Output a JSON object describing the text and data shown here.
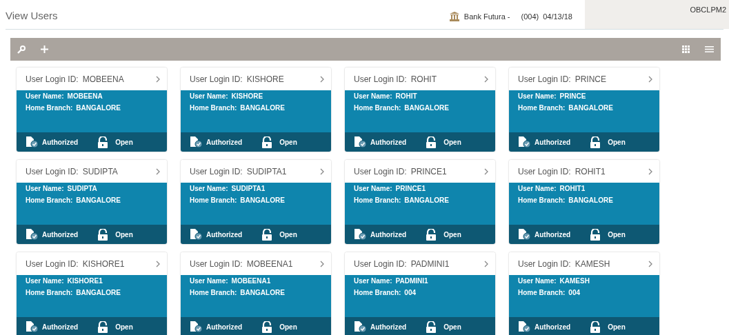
{
  "page": {
    "title": "View Users"
  },
  "header": {
    "bank": "Bank Futura -",
    "branch": "(004)",
    "date": "04/13/18",
    "user": "OBCLPM2"
  },
  "users": [
    {
      "login_label": "User Login ID:",
      "login_id": "MOBEENA",
      "name_label": "User Name:",
      "user_name": "MOBEENA",
      "branch_label": "Home Branch:",
      "home_branch": "BANGALORE",
      "auth_status": "Authorized",
      "record_status": "Open"
    },
    {
      "login_label": "User Login ID:",
      "login_id": "KISHORE",
      "name_label": "User Name:",
      "user_name": "KISHORE",
      "branch_label": "Home Branch:",
      "home_branch": "BANGALORE",
      "auth_status": "Authorized",
      "record_status": "Open"
    },
    {
      "login_label": "User Login ID:",
      "login_id": "ROHIT",
      "name_label": "User Name:",
      "user_name": "ROHIT",
      "branch_label": "Home Branch:",
      "home_branch": "BANGALORE",
      "auth_status": "Authorized",
      "record_status": "Open"
    },
    {
      "login_label": "User Login ID:",
      "login_id": "PRINCE",
      "name_label": "User Name:",
      "user_name": "PRINCE",
      "branch_label": "Home Branch:",
      "home_branch": "BANGALORE",
      "auth_status": "Authorized",
      "record_status": "Open"
    },
    {
      "login_label": "User Login ID:",
      "login_id": "SUDIPTA",
      "name_label": "User Name:",
      "user_name": "SUDIPTA",
      "branch_label": "Home Branch:",
      "home_branch": "BANGALORE",
      "auth_status": "Authorized",
      "record_status": "Open"
    },
    {
      "login_label": "User Login ID:",
      "login_id": "SUDIPTA1",
      "name_label": "User Name:",
      "user_name": "SUDIPTA1",
      "branch_label": "Home Branch:",
      "home_branch": "BANGALORE",
      "auth_status": "Authorized",
      "record_status": "Open"
    },
    {
      "login_label": "User Login ID:",
      "login_id": "PRINCE1",
      "name_label": "User Name:",
      "user_name": "PRINCE1",
      "branch_label": "Home Branch:",
      "home_branch": "BANGALORE",
      "auth_status": "Authorized",
      "record_status": "Open"
    },
    {
      "login_label": "User Login ID:",
      "login_id": "ROHIT1",
      "name_label": "User Name:",
      "user_name": "ROHIT1",
      "branch_label": "Home Branch:",
      "home_branch": "BANGALORE",
      "auth_status": "Authorized",
      "record_status": "Open"
    },
    {
      "login_label": "User Login ID:",
      "login_id": "KISHORE1",
      "name_label": "User Name:",
      "user_name": "KISHORE1",
      "branch_label": "Home Branch:",
      "home_branch": "BANGALORE",
      "auth_status": "Authorized",
      "record_status": "Open"
    },
    {
      "login_label": "User Login ID:",
      "login_id": "MOBEENA1",
      "name_label": "User Name:",
      "user_name": "MOBEENA1",
      "branch_label": "Home Branch:",
      "home_branch": "BANGALORE",
      "auth_status": "Authorized",
      "record_status": "Open"
    },
    {
      "login_label": "User Login ID:",
      "login_id": "PADMINI1",
      "name_label": "User Name:",
      "user_name": "PADMINI1",
      "branch_label": "Home Branch:",
      "home_branch": "004",
      "auth_status": "Authorized",
      "record_status": "Open"
    },
    {
      "login_label": "User Login ID:",
      "login_id": "KAMESH",
      "name_label": "User Name:",
      "user_name": "KAMESH",
      "branch_label": "Home Branch:",
      "home_branch": "004",
      "auth_status": "Authorized",
      "record_status": "Open"
    }
  ]
}
